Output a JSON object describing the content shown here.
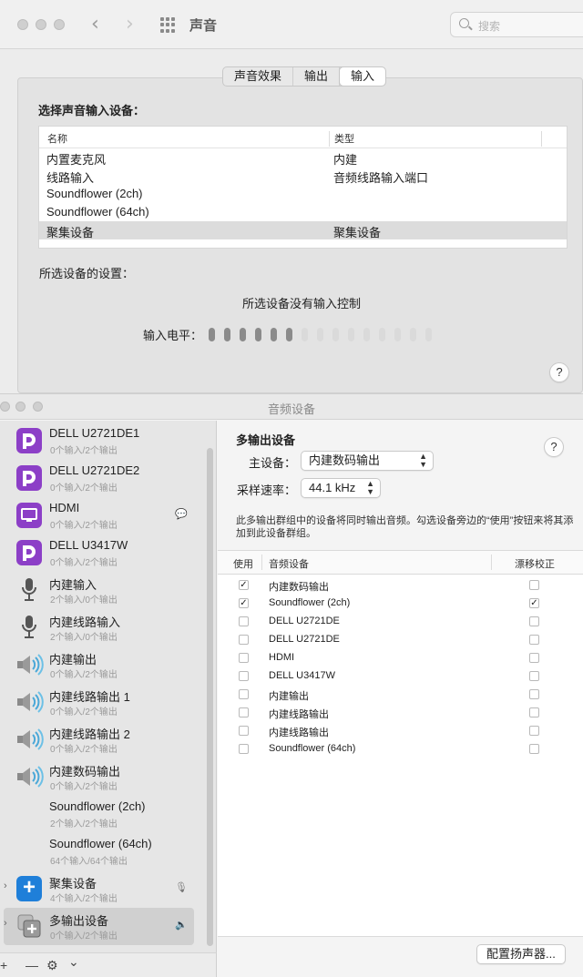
{
  "sound_window": {
    "title": "声音",
    "search_placeholder": "搜索",
    "tabs": [
      {
        "label": "声音效果",
        "active": false
      },
      {
        "label": "输出",
        "active": false
      },
      {
        "label": "输入",
        "active": true
      }
    ],
    "select_input_label": "选择声音输入设备：",
    "columns": {
      "name": "名称",
      "type": "类型"
    },
    "devices": [
      {
        "name": "内置麦克风",
        "type": "内建"
      },
      {
        "name": "线路输入",
        "type": "音频线路输入端口"
      },
      {
        "name": "Soundflower (2ch)",
        "type": ""
      },
      {
        "name": "Soundflower (64ch)",
        "type": ""
      },
      {
        "name": "聚集设备",
        "type": "聚集设备",
        "selected": true
      }
    ],
    "settings_label": "所选设备的设置：",
    "no_control_text": "所选设备没有输入控制",
    "input_level_label": "输入电平：",
    "input_level": {
      "active_bars": 6,
      "total_bars": 15
    },
    "help_label": "?"
  },
  "audio_window": {
    "title": "音频设备",
    "sidebar": [
      {
        "name": "DELL U2721DE1",
        "sub": "0个输入/2个输出",
        "icon": "displayport-icon"
      },
      {
        "name": "DELL U2721DE2",
        "sub": "0个输入/2个输出",
        "icon": "displayport-icon"
      },
      {
        "name": "HDMI",
        "sub": "0个输入/2个输出",
        "icon": "hdmi-icon",
        "badge": "speech-bubble-icon"
      },
      {
        "name": "DELL U3417W",
        "sub": "0个输入/2个输出",
        "icon": "displayport-icon"
      },
      {
        "name": "内建输入",
        "sub": "2个输入/0个输出",
        "icon": "microphone-icon"
      },
      {
        "name": "内建线路输入",
        "sub": "2个输入/0个输出",
        "icon": "microphone-icon"
      },
      {
        "name": "内建输出",
        "sub": "0个输入/2个输出",
        "icon": "speaker-icon"
      },
      {
        "name": "内建线路输出 1",
        "sub": "0个输入/2个输出",
        "icon": "speaker-icon"
      },
      {
        "name": "内建线路输出 2",
        "sub": "0个输入/2个输出",
        "icon": "speaker-icon"
      },
      {
        "name": "内建数码输出",
        "sub": "0个输入/2个输出",
        "icon": "speaker-icon"
      },
      {
        "name": "Soundflower (2ch)",
        "sub": "2个输入/2个输出",
        "icon": ""
      },
      {
        "name": "Soundflower (64ch)",
        "sub": "64个输入/64个输出",
        "icon": ""
      },
      {
        "name": "聚集设备",
        "sub": "4个输入/2个输出",
        "icon": "plus-icon",
        "badge": "microphone-small-icon",
        "disclosure": true
      },
      {
        "name": "多输出设备",
        "sub": "0个输入/2个输出",
        "icon": "multi-output-icon",
        "badge": "speaker-small-icon",
        "disclosure": true,
        "selected": true
      }
    ],
    "footer": {
      "add": "+",
      "remove": "—",
      "gear": "⚙",
      "chevron": "⌄"
    },
    "detail": {
      "title": "多输出设备",
      "master_label": "主设备：",
      "master_value": "内建数码输出",
      "sample_rate_label": "采样速率：",
      "sample_rate_value": "44.1 kHz",
      "help_label": "?",
      "description": "此多输出群组中的设备将同时输出音频。勾选设备旁边的“使用”按钮来将其添加到此设备群组。",
      "columns": {
        "use": "使用",
        "device": "音频设备",
        "drift": "漂移校正"
      },
      "rows": [
        {
          "name": "内建数码输出",
          "use": true,
          "drift": false
        },
        {
          "name": "Soundflower (2ch)",
          "use": true,
          "drift": true
        },
        {
          "name": "DELL U2721DE",
          "use": false,
          "drift": false
        },
        {
          "name": "DELL U2721DE",
          "use": false,
          "drift": false
        },
        {
          "name": "HDMI",
          "use": false,
          "drift": false
        },
        {
          "name": "DELL U3417W",
          "use": false,
          "drift": false
        },
        {
          "name": "内建输出",
          "use": false,
          "drift": false
        },
        {
          "name": "内建线路输出",
          "use": false,
          "drift": false
        },
        {
          "name": "内建线路输出",
          "use": false,
          "drift": false
        },
        {
          "name": "Soundflower (64ch)",
          "use": false,
          "drift": false
        }
      ],
      "configure_button": "配置扬声器..."
    }
  }
}
